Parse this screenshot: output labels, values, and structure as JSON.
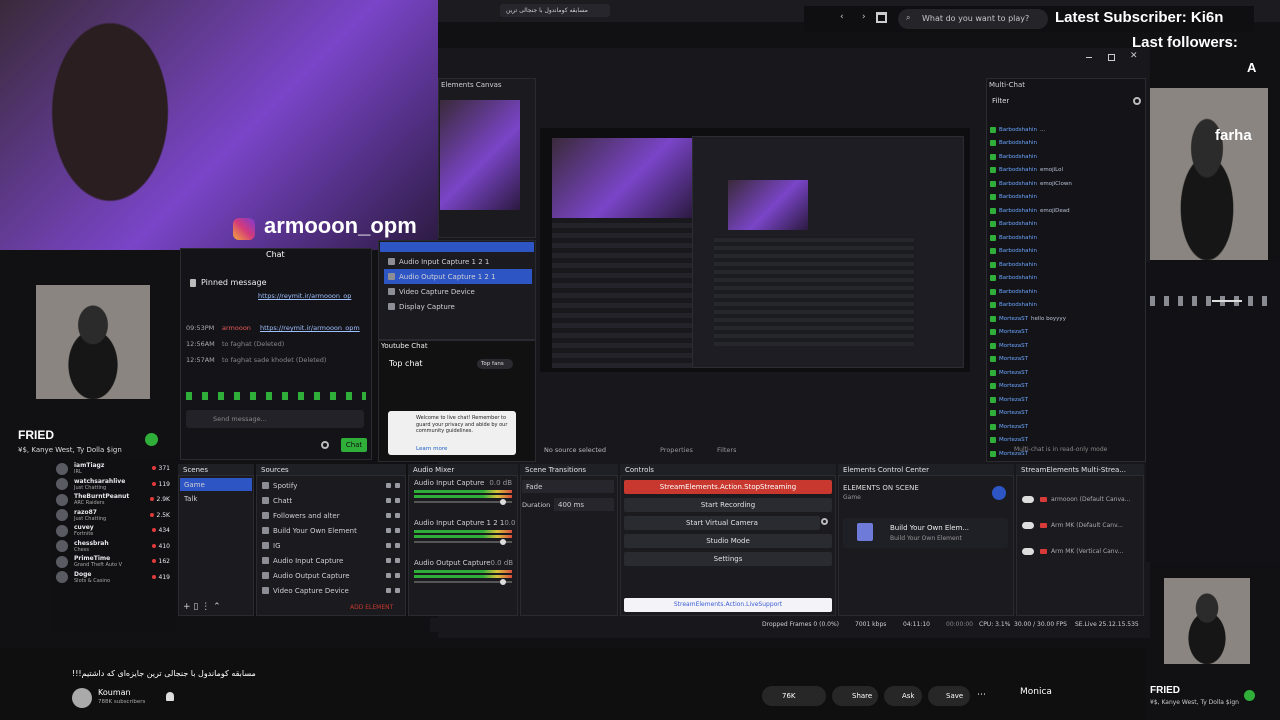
{
  "browser": {
    "tab_title": "مسابقه کوماندول با جنجالی ترین",
    "search_placeholder": "What do you want to play?"
  },
  "overlay": {
    "latest_sub_label": "Latest Subscriber: Ki6n",
    "last_followers_label": "Last followers:",
    "follower_initial": "A",
    "follower_name": "farha"
  },
  "instagram": {
    "handle": "armooon_opm"
  },
  "now_playing": {
    "title": "FRIED",
    "artist": "¥$, Kanye West, Ty Dolla $ign"
  },
  "now_playing_right": {
    "title": "FRIED",
    "artist": "¥$, Kanye West, Ty Dolla $ign"
  },
  "kick_chat": {
    "title": "Chat",
    "pinned_label": "Pinned message",
    "pinned_link": "https://reymit.ir/armooon_op",
    "messages": [
      {
        "time": "09:53PM",
        "user": "armooon",
        "text": "https://reymit.ir/armooon_opm"
      },
      {
        "time": "12:56AM",
        "user": "",
        "text": "to faghat (Deleted)"
      },
      {
        "time": "12:57AM",
        "user": "",
        "text": "to faghat sade khodet (Deleted)"
      }
    ],
    "send_placeholder": "Send message...",
    "chat_button": "Chat"
  },
  "sources_list": {
    "items": [
      "Audio Input Capture 1 2 1",
      "Audio Output Capture 1 2 1",
      "Video Capture Device",
      "Display Capture"
    ]
  },
  "youtube_chat": {
    "title": "Youtube Chat",
    "filter": "Top chat",
    "badge": "Top fans",
    "welcome": "Welcome to live chat! Remember to guard your privacy and abide by our community guidelines.",
    "learn_more": "Learn more"
  },
  "canvas": {
    "title": "Elements Canvas",
    "no_source": "No source selected",
    "properties": "Properties",
    "filters": "Filters"
  },
  "multichat": {
    "title": "Multi-Chat",
    "filter": "Filter",
    "read_only": "Multi-chat is in read-only mode",
    "users": [
      "Barbodshahin",
      "Barbodshahin",
      "Barbodshahin",
      "Barbodshahin",
      "Barbodshahin",
      "Barbodshahin",
      "Barbodshahin",
      "Barbodshahin",
      "Barbodshahin",
      "Barbodshahin",
      "Barbodshahin",
      "Barbodshahin",
      "Barbodshahin",
      "Barbodshahin",
      "MortezaST",
      "MortezaST",
      "MortezaST",
      "MortezaST",
      "MortezaST",
      "MortezaST",
      "MortezaST",
      "MortezaST",
      "MortezaST",
      "MortezaST",
      "MortezaST"
    ],
    "texts": [
      "...",
      "",
      "",
      "emojiLol",
      "emojiClown",
      "",
      "emojiDead",
      "",
      "",
      "",
      "",
      "",
      "",
      "",
      "hello boyyyy",
      "",
      "",
      "",
      "",
      "",
      "",
      "",
      "",
      "",
      ""
    ]
  },
  "followed": [
    {
      "name": "iamTiagz",
      "game": "IRL",
      "viewers": "371"
    },
    {
      "name": "watchsarahlive",
      "game": "Just Chatting",
      "viewers": "119"
    },
    {
      "name": "TheBurntPeanut",
      "game": "ARC Raiders",
      "viewers": "2.9K"
    },
    {
      "name": "razo87",
      "game": "Just Chatting",
      "viewers": "2.5K"
    },
    {
      "name": "cuvey",
      "game": "Fortnite",
      "viewers": "434"
    },
    {
      "name": "chessbrah",
      "game": "Chess",
      "viewers": "410"
    },
    {
      "name": "PrimeTime",
      "game": "Grand Theft Auto V",
      "viewers": "162"
    },
    {
      "name": "Doge",
      "game": "Slots & Casino",
      "viewers": "419"
    }
  ],
  "scenes": {
    "title": "Scenes",
    "items": [
      "Game",
      "Talk"
    ]
  },
  "sources": {
    "title": "Sources",
    "items": [
      "Spotify",
      "Chatt",
      "Followers and alter",
      "Build Your Own Element",
      "IG",
      "Audio Input Capture",
      "Audio Output Capture",
      "Video Capture Device"
    ],
    "add_element": "ADD ELEMENT"
  },
  "mixer": {
    "title": "Audio Mixer",
    "channels": [
      {
        "name": "Audio Input Capture",
        "db": "0.0 dB"
      },
      {
        "name": "Audio Input Capture 1 2 1",
        "db": "0.0 dB"
      },
      {
        "name": "Audio Output Capture",
        "db": "0.0 dB"
      }
    ]
  },
  "transitions": {
    "title": "Scene Transitions",
    "type": "Fade",
    "duration_label": "Duration",
    "duration": "400 ms"
  },
  "controls": {
    "title": "Controls",
    "stop": "StreamElements.Action.StopStreaming",
    "start_recording": "Start Recording",
    "virtual_camera": "Start Virtual Camera",
    "studio_mode": "Studio Mode",
    "settings": "Settings",
    "support": "StreamElements.Action.LiveSupport"
  },
  "elements_center": {
    "title": "Elements Control Center",
    "on_scene": "ELEMENTS ON SCENE",
    "scene": "Game",
    "element_name": "Build Your Own Elem...",
    "element_sub": "Build Your Own Element"
  },
  "multistream": {
    "title": "StreamElements Multi-Strea...",
    "rows": [
      "armooon (Default Canva...",
      "Arm MK (Default Canv...",
      "Arm MK (Vertical Canv..."
    ]
  },
  "statusbar": {
    "dropped": "Dropped Frames 0 (0.0%)",
    "kbps": "7001 kbps",
    "time1": "04:11:10",
    "time2": "00:00:00",
    "cpu": "CPU: 3.1%",
    "fps": "30.00 / 30.00 FPS",
    "ver": "SE.Live 25.12.15.535"
  },
  "video": {
    "title": "!!!مسابقه کوماندول با جنجالی ترین جایزه‌ای که داشتیم",
    "channel": "Kouman",
    "subs": "788K subscribers",
    "likes": "76K",
    "share": "Share",
    "ask": "Ask",
    "save": "Save",
    "monica": "Monica"
  },
  "colors": {
    "accent_red": "#c8382f",
    "obs_bg": "#1a1a1f",
    "kick_green": "#2fae3a",
    "select_blue": "#2d55c4"
  }
}
